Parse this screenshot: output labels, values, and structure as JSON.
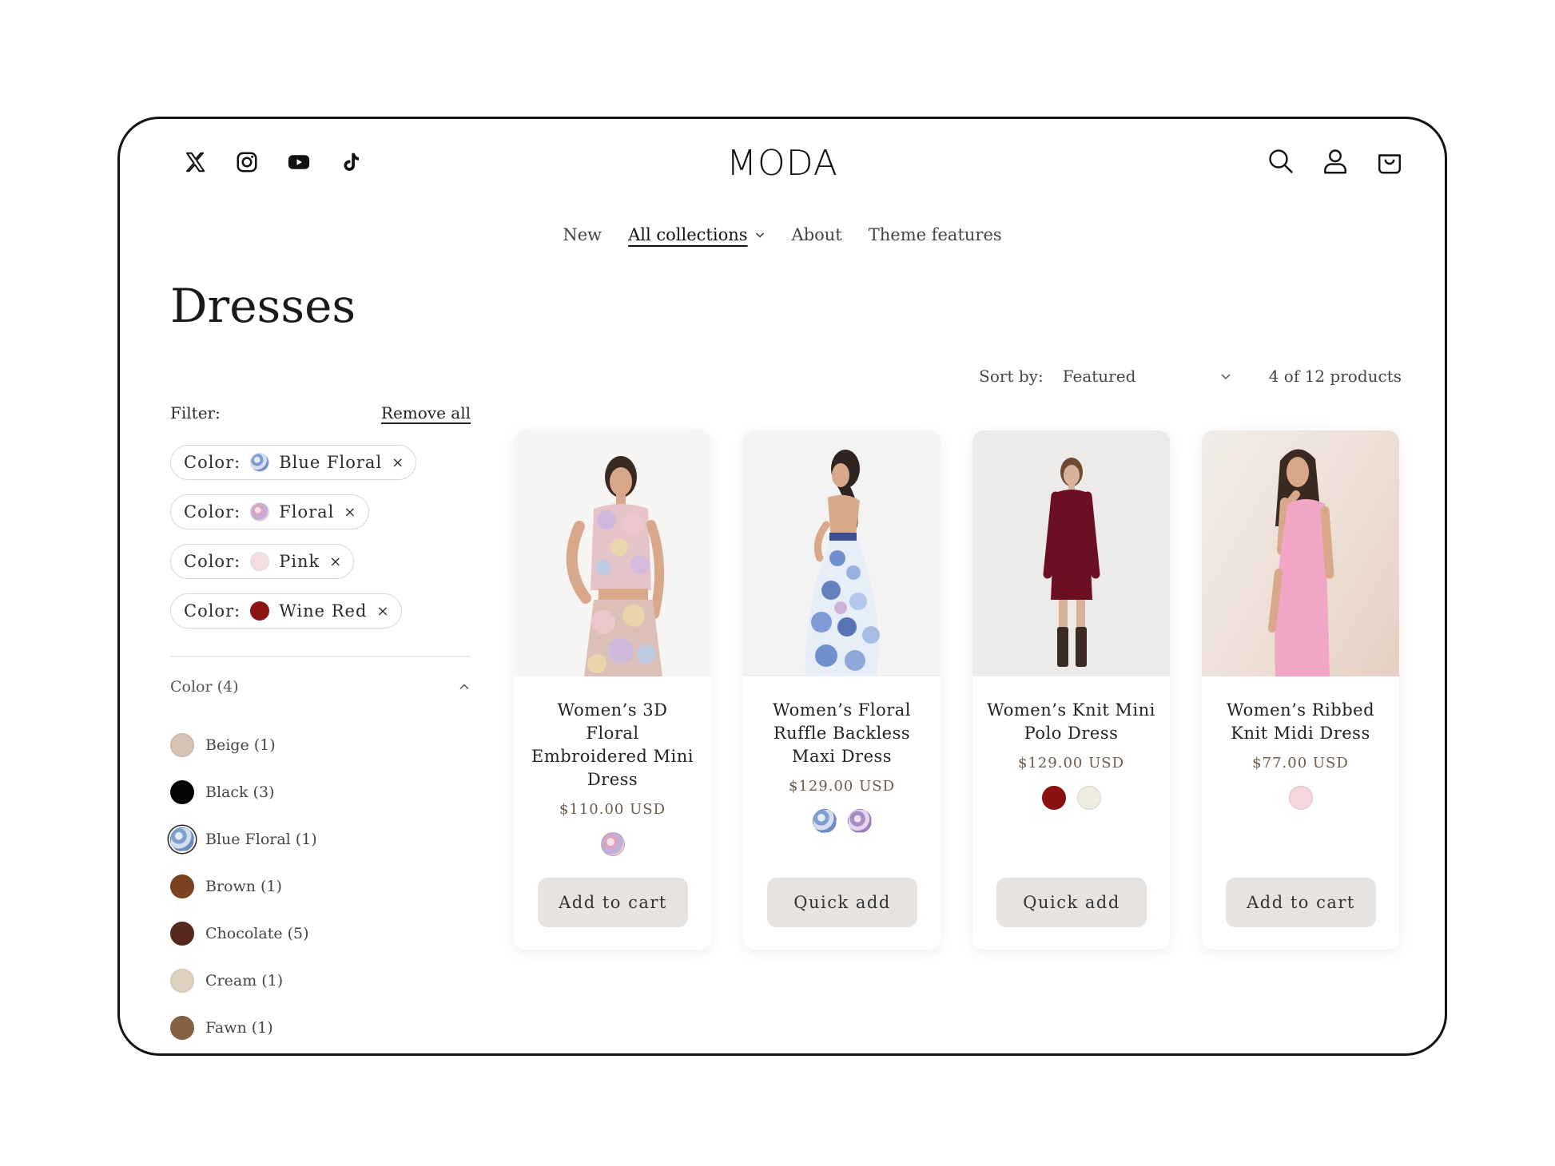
{
  "brand": {
    "name": "MODA"
  },
  "social": [
    "x-icon",
    "instagram-icon",
    "youtube-icon",
    "tiktok-icon"
  ],
  "header_icons": [
    "search-icon",
    "account-icon",
    "cart-icon"
  ],
  "nav": {
    "items": [
      "New",
      "All collections",
      "About",
      "Theme features"
    ],
    "active": "All collections"
  },
  "page": {
    "title": "Dresses"
  },
  "sort": {
    "label": "Sort by:",
    "value": "Featured",
    "count": "4 of 12 products"
  },
  "filter": {
    "label": "Filter:",
    "remove_all": "Remove all",
    "chips": [
      {
        "prefix": "Color:",
        "value": "Blue Floral",
        "swatch": "#b8cbe6"
      },
      {
        "prefix": "Color:",
        "value": "Floral",
        "swatch": "#e9c7cf"
      },
      {
        "prefix": "Color:",
        "value": "Pink",
        "swatch": "#f5dde1"
      },
      {
        "prefix": "Color:",
        "value": "Wine Red",
        "swatch": "#8d1414"
      }
    ],
    "remove_glyph": "×",
    "color_group": "Color (4)",
    "colors": [
      {
        "label": "Beige (1)",
        "swatch": "#d4c2b3"
      },
      {
        "label": "Black (3)",
        "swatch": "#050505"
      },
      {
        "label": "Blue Floral (1)",
        "swatch": "#a9c0de",
        "selected": true
      },
      {
        "label": "Brown (1)",
        "swatch": "#7a421f"
      },
      {
        "label": "Chocolate (5)",
        "swatch": "#55291f"
      },
      {
        "label": "Cream (1)",
        "swatch": "#dcd2bd"
      },
      {
        "label": "Fawn (1)",
        "swatch": "#856244"
      }
    ]
  },
  "products": [
    {
      "title": "Women’s 3D Floral Embroidered Mini Dress",
      "price": "$110.00 USD",
      "swatches": [
        "#d9b8cf"
      ],
      "button": "Add to cart",
      "bg": "#f6f5f4"
    },
    {
      "title": "Women’s Floral Ruffle Backless Maxi Dress",
      "price": "$129.00 USD",
      "swatches": [
        "#a3bfe0",
        "#c5a9cf"
      ],
      "button": "Quick add",
      "bg": "#f3f3f3"
    },
    {
      "title": "Women’s Knit Mini Polo Dress",
      "price": "$129.00 USD",
      "swatches": [
        "#8b1111",
        "#eeece1"
      ],
      "button": "Quick add",
      "bg": "#ecebea"
    },
    {
      "title": "Women’s Ribbed Knit Midi Dress",
      "price": "$77.00 USD",
      "swatches": [
        "#f5d7dd"
      ],
      "button": "Add to cart",
      "bg": "#efe5df"
    }
  ]
}
